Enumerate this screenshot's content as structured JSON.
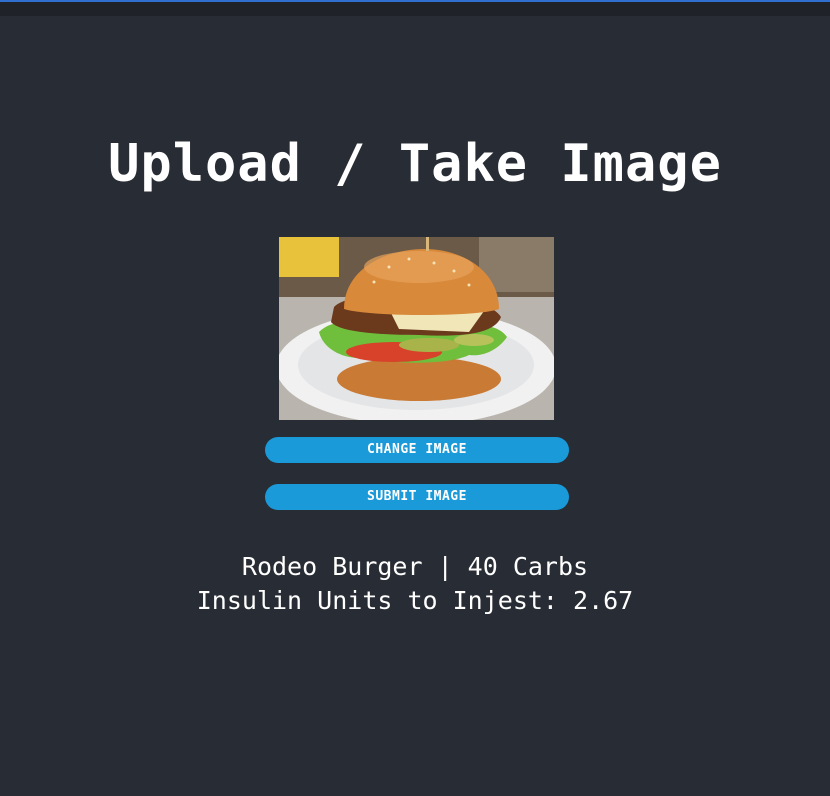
{
  "page": {
    "title": "Upload / Take Image"
  },
  "image": {
    "alt": "burger-photo"
  },
  "buttons": {
    "change_label": "CHANGE IMAGE",
    "submit_label": "SUBMIT IMAGE"
  },
  "result": {
    "food_line": "Rodeo Burger | 40 Carbs",
    "insulin_line": "Insulin Units to Injest: 2.67"
  },
  "colors": {
    "background": "#282c34",
    "button": "#1a9ad9",
    "text": "#ffffff"
  }
}
